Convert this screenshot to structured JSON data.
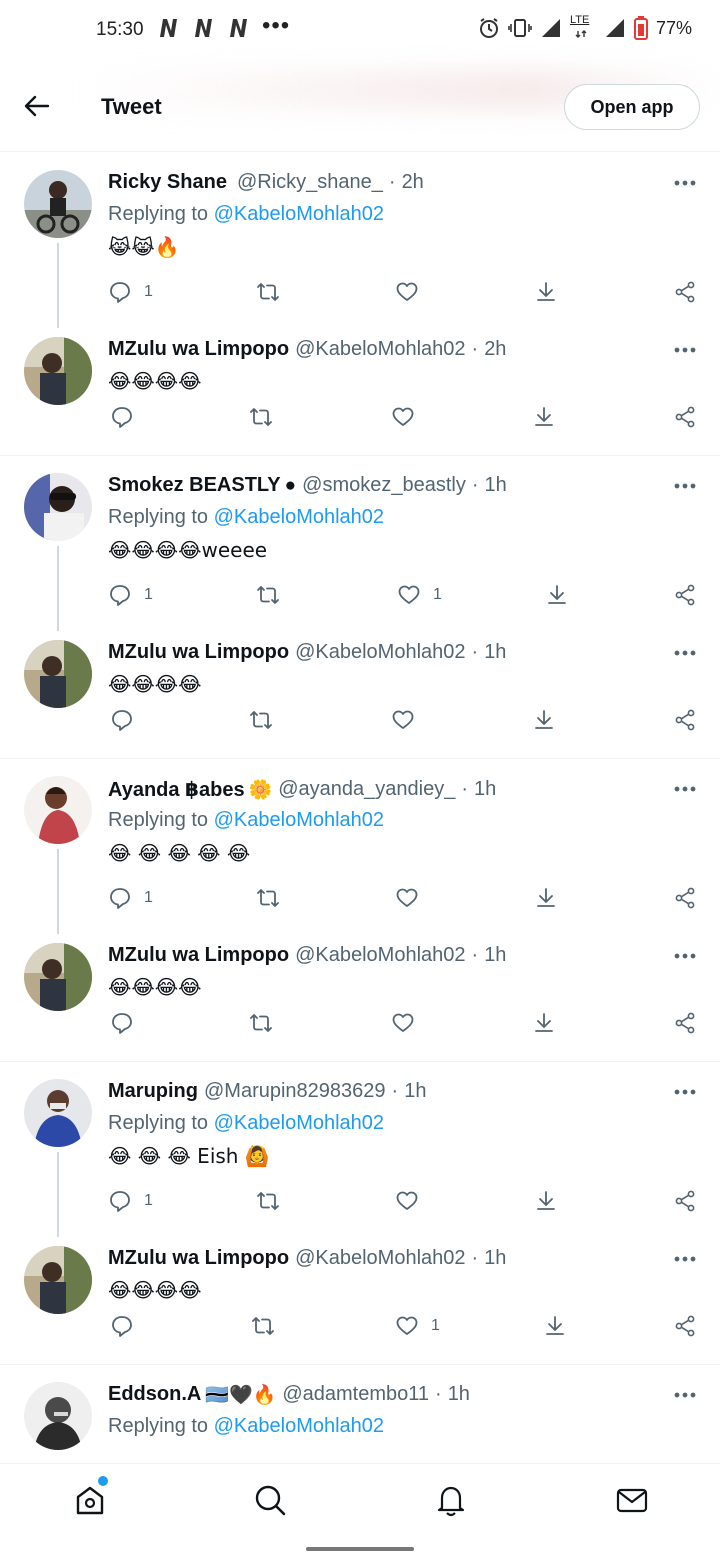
{
  "status_bar": {
    "time": "15:30",
    "dots": "•••",
    "network": "LTE",
    "battery": "77%",
    "notification_icons": [
      "netflix-n-icon",
      "netflix-n-icon",
      "netflix-n-icon"
    ]
  },
  "header": {
    "title": "Tweet",
    "open_app_label": "Open app"
  },
  "replying_label": "Replying to",
  "tweets": [
    {
      "name": "Ricky Shane",
      "extra": "",
      "handle": "@Ricky_shane_",
      "sep": "·",
      "time": "2h",
      "replying_to": "@KabeloMohlah02",
      "text": "😹😹🔥",
      "reply_count": "1",
      "like_count": ""
    },
    {
      "name": "MZulu wa Limpopo",
      "extra": "",
      "handle": "@KabeloMohlah02",
      "sep": "·",
      "time": "2h",
      "text": "😂😂😂😂",
      "reply_count": "",
      "like_count": ""
    },
    {
      "name": "Smokez BEASTLY",
      "extra": "●",
      "handle": "@smokez_beastly",
      "sep": "·",
      "time": "1h",
      "replying_to": "@KabeloMohlah02",
      "text": "😂😂😂😂weeee",
      "reply_count": "1",
      "like_count": "1"
    },
    {
      "name": "MZulu wa Limpopo",
      "extra": "",
      "handle": "@KabeloMohlah02",
      "sep": "·",
      "time": "1h",
      "text": "😂😂😂😂",
      "reply_count": "",
      "like_count": ""
    },
    {
      "name": "Ayanda ฿abes",
      "extra": "🌼",
      "handle": "@ayanda_yandiey_",
      "sep": "·",
      "time": "1h",
      "replying_to": "@KabeloMohlah02",
      "text": "😂 😂 😂 😂 😂",
      "reply_count": "1",
      "like_count": ""
    },
    {
      "name": "MZulu wa Limpopo",
      "extra": "",
      "handle": "@KabeloMohlah02",
      "sep": "·",
      "time": "1h",
      "text": "😂😂😂😂",
      "reply_count": "",
      "like_count": ""
    },
    {
      "name": "Maruping",
      "extra": "",
      "handle": "@Marupin82983629",
      "sep": "·",
      "time": "1h",
      "replying_to": "@KabeloMohlah02",
      "text": "😂 😂 😂 Eish 🙆",
      "reply_count": "1",
      "like_count": ""
    },
    {
      "name": "MZulu wa Limpopo",
      "extra": "",
      "handle": "@KabeloMohlah02",
      "sep": "·",
      "time": "1h",
      "text": "😂😂😂😂",
      "reply_count": "",
      "like_count": "1"
    },
    {
      "name": "Eddson.A",
      "extra": "🇧🇼🖤🔥",
      "handle": "@adamtembo11",
      "sep": "·",
      "time": "1h",
      "replying_to": "@KabeloMohlah02",
      "text": "",
      "reply_count": "",
      "like_count": ""
    }
  ],
  "colors": {
    "accent": "#1d9bf0",
    "secondary_text": "#536471",
    "thread_line": "#cfd9de"
  },
  "bottom_nav": [
    "home-icon",
    "search-icon",
    "notifications-bell-icon",
    "messages-envelope-icon"
  ]
}
